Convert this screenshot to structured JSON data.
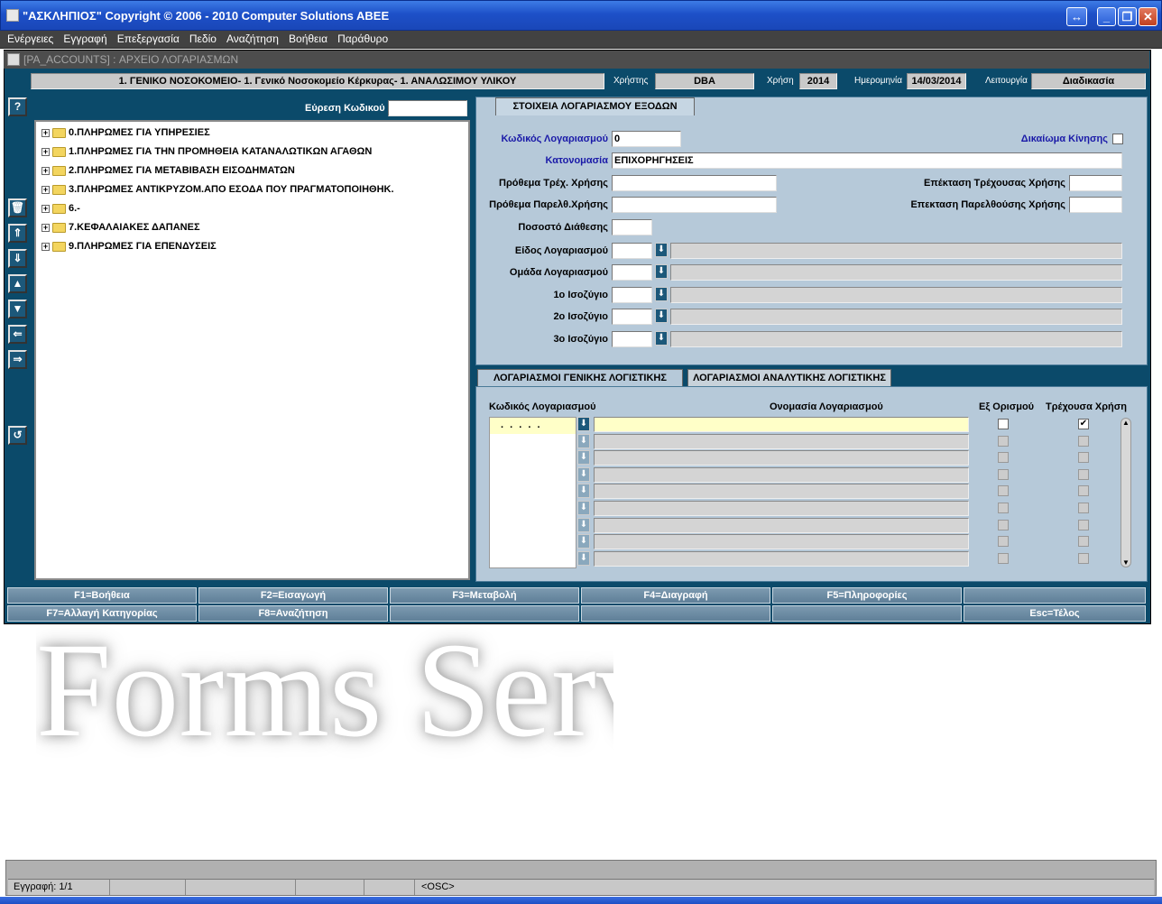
{
  "window": {
    "title": "\"ΑΣΚΛΗΠΙΟΣ\" Copyright © 2006 - 2010 Computer Solutions ABEE"
  },
  "menu": [
    "Ενέργειες",
    "Εγγραφή",
    "Επεξεργασία",
    "Πεδίο",
    "Αναζήτηση",
    "Βοήθεια",
    "Παράθυρο"
  ],
  "form": {
    "code": "[PA_ACCOUNTS]",
    "separator": ":",
    "name": "ΑΡΧΕΙΟ ΛΟΓΑΡΙΑΣΜΩΝ"
  },
  "header": {
    "organization": "1. ΓΕΝΙΚΟ ΝΟΣΟΚΟΜΕΙΟ- 1. Γενικό Νοσοκομείο Κέρκυρας- 1. ΑΝΑΛΩΣΙΜΟΥ ΥΛΙΚΟΥ",
    "user_label": "Χρήστης",
    "user": "DBA",
    "year_label": "Χρήση",
    "year": "2014",
    "date_label": "Ημερομηνία",
    "date": "14/03/2014",
    "function_label": "Λειτουργία",
    "function": "Διαδικασία"
  },
  "tree": {
    "search_label": "Εύρεση Κωδικού",
    "search_value": "",
    "items": [
      "0.ΠΛΗΡΩΜΕΣ ΓΙΑ ΥΠΗΡΕΣΙΕΣ",
      "1.ΠΛΗΡΩΜΕΣ ΓΙΑ ΤΗΝ ΠΡΟΜΗΘΕΙΑ ΚΑΤΑΝΑΛΩΤΙΚΩΝ ΑΓΑΘΩΝ",
      "2.ΠΛΗΡΩΜΕΣ ΓΙΑ ΜΕΤΑΒΙΒΑΣΗ ΕΙΣΟΔΗΜΑΤΩΝ",
      "3.ΠΛΗΡΩΜΕΣ ΑΝΤΙΚΡΥΖΟΜ.ΑΠΟ ΕΣΟΔΑ ΠΟΥ ΠΡΑΓΜΑΤΟΠΟΙΗΘΗΚ.",
      "6.-",
      "7.ΚΕΦΑΛΑΙΑΚΕΣ ΔΑΠΑΝΕΣ",
      "9.ΠΛΗΡΩΜΕΣ ΓΙΑ ΕΠΕΝΔΥΣΕΙΣ"
    ]
  },
  "details": {
    "tab": "ΣΤΟΙΧΕΙΑ ΛΟΓΑΡΙΑΣΜΟΥ ΕΞΟΔΩΝ",
    "account_code_label": "Κωδικός Λογαριασμού",
    "account_code": "0",
    "movement_right_label": "Δικαίωμα Κίνησης",
    "name_label": "Κατονομασία",
    "name": "ΕΠΙΧΟΡΗΓΗΣΕΙΣ",
    "prefix_cur_label": "Πρόθεμα Τρέχ. Χρήσης",
    "prefix_cur": "",
    "prefix_prev_label": "Πρόθεμα Παρελθ.Χρήσης",
    "prefix_prev": "",
    "ext_cur_label": "Επέκταση Τρέχουσας Χρήσης",
    "ext_cur": "",
    "ext_prev_label": "Επεκταση Παρελθούσης Χρήσης",
    "ext_prev": "",
    "percent_label": "Ποσοστό Διάθεσης",
    "percent": "",
    "type_label": "Είδος Λογαριασμού",
    "group_label": "Ομάδα Λογαριασμού",
    "bal1_label": "1ο Ισοζύγιο",
    "bal2_label": "2ο Ισοζύγιο",
    "bal3_label": "3ο Ισοζύγιο"
  },
  "accounts": {
    "tabs": [
      "ΛΟΓΑΡΙΑΣΜΟΙ ΓΕΝΙΚΗΣ ΛΟΓΙΣΤΙΚΗΣ",
      "ΛΟΓΑΡΙΑΣΜΟΙ ΑΝΑΛΥΤΙΚΗΣ ΛΟΓΙΣΤΙΚΗΣ"
    ],
    "col_code": "Κωδικός Λογαριασμού",
    "col_name": "Ονομασία Λογαριασμού",
    "col_default": "Εξ Ορισμού",
    "col_current": "Τρέχουσα Χρήση",
    "first_row_code": ". . . . .",
    "rows": 9
  },
  "fkeys": [
    "F1=Βοήθεια",
    "F2=Εισαγωγή",
    "F3=Μεταβολή",
    "F4=Διαγραφή",
    "F5=Πληροφορίες",
    "",
    "F7=Αλλαγή Κατηγορίας",
    "F8=Αναζήτηση",
    "",
    "",
    "",
    "Esc=Τέλος"
  ],
  "watermark": "Forms Services",
  "status": {
    "record": "Εγγραφή: 1/1",
    "mode": "<OSC>"
  },
  "colors": {
    "frame": "#0b4a6a",
    "panel": "#b6c9d9",
    "title": "#1d50c8"
  }
}
